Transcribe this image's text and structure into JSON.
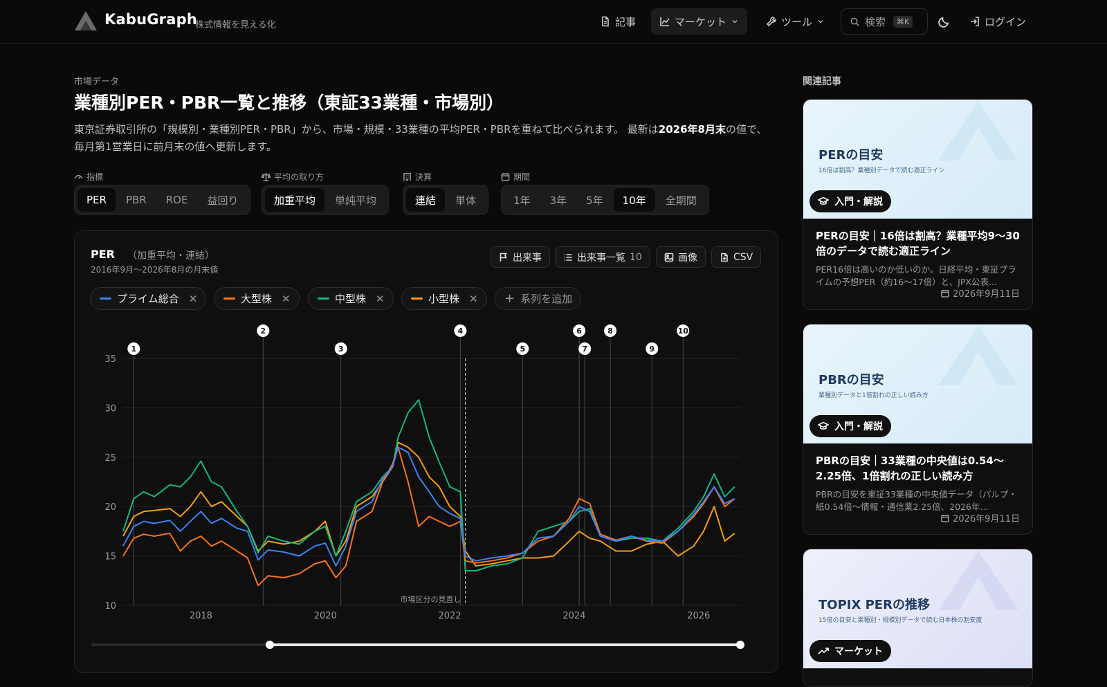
{
  "header": {
    "brand": "KabuGraph",
    "tagline": "株式情報を見える化",
    "nav": [
      {
        "label": "記事",
        "icon": "document-icon"
      },
      {
        "label": "マーケット",
        "icon": "line-chart-icon"
      },
      {
        "label": "ツール",
        "icon": "wrench-icon"
      }
    ],
    "search": {
      "label": "検索",
      "shortcut": "⌘K"
    },
    "login": "ログイン"
  },
  "page": {
    "breadcrumb": "市場データ",
    "title": "業種別PER・PBR一覧と推移（東証33業種・市場別）",
    "desc_1": "東京証券取引所の「規模別・業種別PER・PBR」から、市場・規模・33業種の平均PER・PBRを重ねて比べられます。 最新は",
    "desc_bold": "2026年8月末",
    "desc_2": "の値で、毎月第1営業日に前月末の値へ更新します。"
  },
  "controls": {
    "metric": {
      "label": "指標",
      "options": [
        "PER",
        "PBR",
        "ROE",
        "益回り"
      ],
      "selected": "PER"
    },
    "avg": {
      "label": "平均の取り方",
      "options": [
        "加重平均",
        "単純平均"
      ],
      "selected": "加重平均"
    },
    "basis": {
      "label": "決算",
      "options": [
        "連結",
        "単体"
      ],
      "selected": "連結"
    },
    "period": {
      "label": "期間",
      "options": [
        "1年",
        "3年",
        "5年",
        "10年",
        "全期間"
      ],
      "selected": "10年"
    }
  },
  "card": {
    "metric": "PER",
    "sub": "（加重平均・連結）",
    "range": "2016年9月〜2026年8月の月末値",
    "buttons": {
      "events": "出来事",
      "event_list": "出来事一覧",
      "event_count": "10",
      "image": "画像",
      "csv": "CSV"
    },
    "add_series": "系列を追加"
  },
  "chart_data": {
    "type": "line",
    "y_range": [
      10,
      35
    ],
    "y_ticks": [
      10,
      15,
      20,
      25,
      30,
      35
    ],
    "x_ticks": [
      2018,
      2020,
      2022,
      2024,
      2026
    ],
    "x_range": [
      2016.75,
      2026.67
    ],
    "grid": "horizontal",
    "legend": "top-left",
    "annotation": {
      "x": 2022.25,
      "label": "市場区分の見直し"
    },
    "events": [
      {
        "n": "1",
        "x": 2016.92
      },
      {
        "n": "2",
        "x": 2019.0
      },
      {
        "n": "3",
        "x": 2020.25
      },
      {
        "n": "4",
        "x": 2022.17
      },
      {
        "n": "5",
        "x": 2023.17
      },
      {
        "n": "6",
        "x": 2024.08
      },
      {
        "n": "7",
        "x": 2024.17
      },
      {
        "n": "8",
        "x": 2024.58
      },
      {
        "n": "9",
        "x": 2025.25
      },
      {
        "n": "10",
        "x": 2025.75
      }
    ],
    "series": [
      {
        "name": "プライム総合",
        "color": "#3b82f6",
        "points": [
          [
            2016.75,
            16
          ],
          [
            2016.92,
            18
          ],
          [
            2017.08,
            18.5
          ],
          [
            2017.25,
            18.3
          ],
          [
            2017.5,
            18.6
          ],
          [
            2017.67,
            17.5
          ],
          [
            2017.83,
            18.5
          ],
          [
            2018.0,
            19.5
          ],
          [
            2018.17,
            18.3
          ],
          [
            2018.33,
            18.8
          ],
          [
            2018.58,
            17.8
          ],
          [
            2018.75,
            17.5
          ],
          [
            2018.92,
            14.6
          ],
          [
            2019.08,
            15.6
          ],
          [
            2019.33,
            15.4
          ],
          [
            2019.58,
            15.0
          ],
          [
            2019.83,
            16.0
          ],
          [
            2020.0,
            16.3
          ],
          [
            2020.17,
            14.0
          ],
          [
            2020.33,
            16.0
          ],
          [
            2020.5,
            19.5
          ],
          [
            2020.75,
            20.5
          ],
          [
            2020.92,
            22.8
          ],
          [
            2021.08,
            24.0
          ],
          [
            2021.17,
            26.0
          ],
          [
            2021.33,
            25.5
          ],
          [
            2021.5,
            23.0
          ],
          [
            2021.67,
            21.5
          ],
          [
            2021.83,
            20.0
          ],
          [
            2022.0,
            19.3
          ],
          [
            2022.17,
            18.8
          ],
          [
            2022.25,
            15.0
          ],
          [
            2022.42,
            14.5
          ],
          [
            2022.67,
            14.8
          ],
          [
            2022.92,
            15.0
          ],
          [
            2023.17,
            15.3
          ],
          [
            2023.42,
            16.8
          ],
          [
            2023.67,
            17.0
          ],
          [
            2023.92,
            18.5
          ],
          [
            2024.08,
            20.0
          ],
          [
            2024.25,
            19.5
          ],
          [
            2024.42,
            17.0
          ],
          [
            2024.67,
            16.5
          ],
          [
            2024.92,
            17.0
          ],
          [
            2025.17,
            16.6
          ],
          [
            2025.42,
            16.5
          ],
          [
            2025.67,
            17.5
          ],
          [
            2025.92,
            19.2
          ],
          [
            2026.08,
            20.5
          ],
          [
            2026.25,
            22.0
          ],
          [
            2026.42,
            20.3
          ],
          [
            2026.58,
            20.8
          ]
        ]
      },
      {
        "name": "大型株",
        "color": "#f97316",
        "points": [
          [
            2016.75,
            15
          ],
          [
            2016.92,
            16.8
          ],
          [
            2017.08,
            17.2
          ],
          [
            2017.25,
            17.0
          ],
          [
            2017.5,
            17.3
          ],
          [
            2017.67,
            15.5
          ],
          [
            2017.83,
            16.5
          ],
          [
            2018.0,
            17.0
          ],
          [
            2018.17,
            16.0
          ],
          [
            2018.33,
            16.5
          ],
          [
            2018.58,
            15.5
          ],
          [
            2018.75,
            14.8
          ],
          [
            2018.92,
            12.0
          ],
          [
            2019.08,
            13.0
          ],
          [
            2019.33,
            12.8
          ],
          [
            2019.58,
            13.2
          ],
          [
            2019.83,
            14.2
          ],
          [
            2020.0,
            14.5
          ],
          [
            2020.17,
            12.8
          ],
          [
            2020.33,
            14.0
          ],
          [
            2020.5,
            18.5
          ],
          [
            2020.75,
            19.5
          ],
          [
            2020.92,
            22.5
          ],
          [
            2021.08,
            24.3
          ],
          [
            2021.17,
            26.0
          ],
          [
            2021.33,
            22.5
          ],
          [
            2021.5,
            18.0
          ],
          [
            2021.67,
            19.0
          ],
          [
            2021.83,
            18.5
          ],
          [
            2022.0,
            18.0
          ],
          [
            2022.17,
            18.5
          ],
          [
            2022.25,
            14.5
          ],
          [
            2022.42,
            14.3
          ],
          [
            2022.67,
            14.5
          ],
          [
            2022.92,
            14.8
          ],
          [
            2023.17,
            15.3
          ],
          [
            2023.42,
            16.5
          ],
          [
            2023.67,
            17.0
          ],
          [
            2023.92,
            18.8
          ],
          [
            2024.08,
            20.8
          ],
          [
            2024.25,
            20.3
          ],
          [
            2024.42,
            17.2
          ],
          [
            2024.67,
            16.6
          ],
          [
            2024.92,
            17.0
          ],
          [
            2025.17,
            16.5
          ],
          [
            2025.42,
            16.3
          ],
          [
            2025.67,
            17.5
          ],
          [
            2025.92,
            19.0
          ],
          [
            2026.08,
            20.3
          ],
          [
            2026.25,
            22.0
          ],
          [
            2026.42,
            20.0
          ],
          [
            2026.58,
            20.8
          ]
        ]
      },
      {
        "name": "中型株",
        "color": "#10b981",
        "points": [
          [
            2016.75,
            17.5
          ],
          [
            2016.92,
            20.8
          ],
          [
            2017.08,
            21.5
          ],
          [
            2017.25,
            21.0
          ],
          [
            2017.5,
            22.2
          ],
          [
            2017.67,
            22.0
          ],
          [
            2017.83,
            23.0
          ],
          [
            2018.0,
            24.6
          ],
          [
            2018.17,
            22.5
          ],
          [
            2018.33,
            22.0
          ],
          [
            2018.58,
            19.5
          ],
          [
            2018.75,
            18.0
          ],
          [
            2018.92,
            15.3
          ],
          [
            2019.08,
            17.0
          ],
          [
            2019.33,
            16.5
          ],
          [
            2019.58,
            16.2
          ],
          [
            2019.83,
            17.5
          ],
          [
            2020.0,
            18.0
          ],
          [
            2020.17,
            15.0
          ],
          [
            2020.33,
            17.5
          ],
          [
            2020.5,
            20.5
          ],
          [
            2020.75,
            21.5
          ],
          [
            2020.92,
            23.0
          ],
          [
            2021.08,
            24.0
          ],
          [
            2021.17,
            27.0
          ],
          [
            2021.33,
            29.5
          ],
          [
            2021.5,
            30.8
          ],
          [
            2021.67,
            27.0
          ],
          [
            2021.83,
            24.5
          ],
          [
            2022.0,
            22.0
          ],
          [
            2022.17,
            21.5
          ],
          [
            2022.25,
            13.5
          ],
          [
            2022.42,
            13.5
          ],
          [
            2022.67,
            14.0
          ],
          [
            2022.92,
            14.2
          ],
          [
            2023.17,
            14.8
          ],
          [
            2023.42,
            17.5
          ],
          [
            2023.67,
            18.0
          ],
          [
            2023.92,
            18.5
          ],
          [
            2024.08,
            19.5
          ],
          [
            2024.25,
            19.8
          ],
          [
            2024.42,
            17.0
          ],
          [
            2024.67,
            16.5
          ],
          [
            2024.92,
            16.8
          ],
          [
            2025.17,
            16.8
          ],
          [
            2025.42,
            16.5
          ],
          [
            2025.67,
            17.8
          ],
          [
            2025.92,
            19.5
          ],
          [
            2026.08,
            21.0
          ],
          [
            2026.25,
            23.3
          ],
          [
            2026.42,
            21.0
          ],
          [
            2026.58,
            22.0
          ]
        ]
      },
      {
        "name": "小型株",
        "color": "#f59e0b",
        "points": [
          [
            2016.75,
            17
          ],
          [
            2016.92,
            19.0
          ],
          [
            2017.08,
            19.5
          ],
          [
            2017.25,
            19.6
          ],
          [
            2017.5,
            19.8
          ],
          [
            2017.67,
            19.0
          ],
          [
            2017.83,
            20.0
          ],
          [
            2018.0,
            21.5
          ],
          [
            2018.17,
            20.0
          ],
          [
            2018.33,
            20.5
          ],
          [
            2018.58,
            19.0
          ],
          [
            2018.75,
            18.0
          ],
          [
            2018.92,
            15.5
          ],
          [
            2019.08,
            16.5
          ],
          [
            2019.33,
            16.2
          ],
          [
            2019.58,
            16.5
          ],
          [
            2019.83,
            17.5
          ],
          [
            2020.0,
            18.5
          ],
          [
            2020.17,
            15.0
          ],
          [
            2020.33,
            16.5
          ],
          [
            2020.5,
            20.0
          ],
          [
            2020.75,
            21.0
          ],
          [
            2020.92,
            22.5
          ],
          [
            2021.08,
            24.0
          ],
          [
            2021.17,
            26.5
          ],
          [
            2021.33,
            26.0
          ],
          [
            2021.5,
            25.0
          ],
          [
            2021.67,
            23.0
          ],
          [
            2021.83,
            22.0
          ],
          [
            2022.0,
            20.0
          ],
          [
            2022.17,
            19.0
          ],
          [
            2022.25,
            15.5
          ],
          [
            2022.42,
            14.0
          ],
          [
            2022.67,
            14.2
          ],
          [
            2022.92,
            14.5
          ],
          [
            2023.17,
            14.8
          ],
          [
            2023.42,
            14.8
          ],
          [
            2023.67,
            15.0
          ],
          [
            2023.92,
            16.5
          ],
          [
            2024.08,
            17.5
          ],
          [
            2024.25,
            16.8
          ],
          [
            2024.42,
            16.5
          ],
          [
            2024.67,
            15.5
          ],
          [
            2024.92,
            15.5
          ],
          [
            2025.17,
            16.2
          ],
          [
            2025.42,
            16.5
          ],
          [
            2025.67,
            15.0
          ],
          [
            2025.92,
            16.0
          ],
          [
            2026.08,
            17.5
          ],
          [
            2026.25,
            20.0
          ],
          [
            2026.42,
            16.5
          ],
          [
            2026.58,
            17.3
          ]
        ]
      }
    ]
  },
  "sidebar": {
    "heading": "関連記事",
    "articles": [
      {
        "thumb_title": "PERの目安",
        "thumb_sub": "16倍は割高？業種別データで読む適正ライン",
        "tag": "入門・解説",
        "title": "PERの目安｜16倍は割高？業種平均9〜30倍のデータで読む適正ライン",
        "excerpt": "PER16倍は高いのか低いのか。日経平均・東証プライムの予想PER（約16〜17倍）と、JPX公表...",
        "date": "2026年9月11日"
      },
      {
        "thumb_title": "PBRの目安",
        "thumb_sub": "業種別データと1倍割れの正しい読み方",
        "tag": "入門・解説",
        "title": "PBRの目安｜33業種の中央値は0.54〜2.25倍、1倍割れの正しい読み方",
        "excerpt": "PBRの目安を東証33業種の中央値データ（パルプ・紙0.54倍〜情報・通信業2.25倍、2026年...",
        "date": "2026年9月11日"
      },
      {
        "thumb_title": "TOPIX PERの推移",
        "thumb_sub": "15倍の目安と業種別・規模別データで読む日本株の割安度",
        "tag": "マーケット"
      }
    ]
  }
}
